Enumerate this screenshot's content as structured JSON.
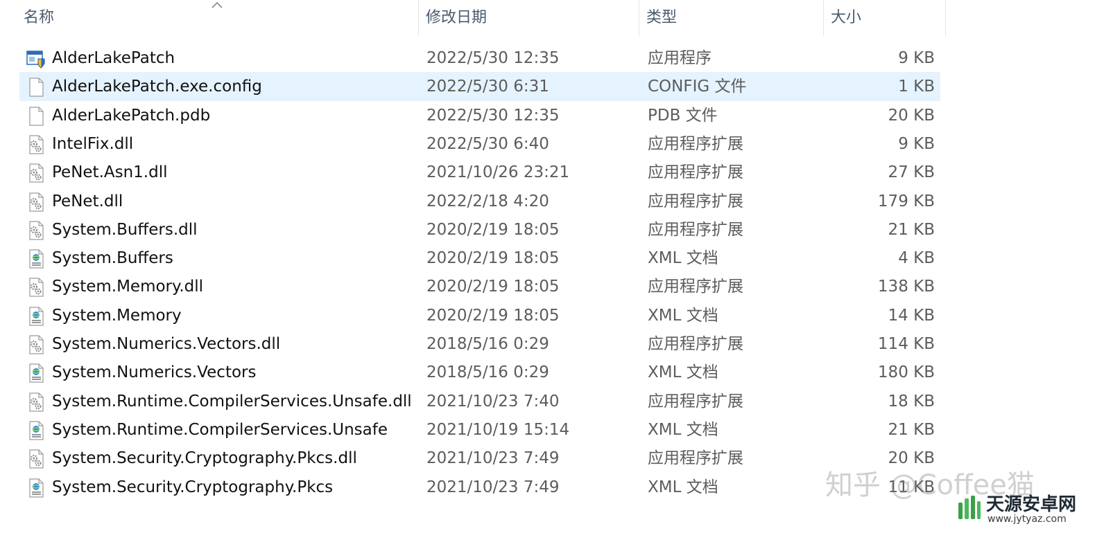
{
  "columns": {
    "name": "名称",
    "date": "修改日期",
    "type": "类型",
    "size": "大小"
  },
  "selected_index": 1,
  "files": [
    {
      "name": "AlderLakePatch",
      "date": "2022/5/30 12:35",
      "type": "应用程序",
      "size": "9 KB",
      "icon": "exe"
    },
    {
      "name": "AlderLakePatch.exe.config",
      "date": "2022/5/30 6:31",
      "type": "CONFIG 文件",
      "size": "1 KB",
      "icon": "file"
    },
    {
      "name": "AlderLakePatch.pdb",
      "date": "2022/5/30 12:35",
      "type": "PDB 文件",
      "size": "20 KB",
      "icon": "file"
    },
    {
      "name": "IntelFix.dll",
      "date": "2022/5/30 6:40",
      "type": "应用程序扩展",
      "size": "9 KB",
      "icon": "dll"
    },
    {
      "name": "PeNet.Asn1.dll",
      "date": "2021/10/26 23:21",
      "type": "应用程序扩展",
      "size": "27 KB",
      "icon": "dll"
    },
    {
      "name": "PeNet.dll",
      "date": "2022/2/18 4:20",
      "type": "应用程序扩展",
      "size": "179 KB",
      "icon": "dll"
    },
    {
      "name": "System.Buffers.dll",
      "date": "2020/2/19 18:05",
      "type": "应用程序扩展",
      "size": "21 KB",
      "icon": "dll"
    },
    {
      "name": "System.Buffers",
      "date": "2020/2/19 18:05",
      "type": "XML 文档",
      "size": "4 KB",
      "icon": "xml"
    },
    {
      "name": "System.Memory.dll",
      "date": "2020/2/19 18:05",
      "type": "应用程序扩展",
      "size": "138 KB",
      "icon": "dll"
    },
    {
      "name": "System.Memory",
      "date": "2020/2/19 18:05",
      "type": "XML 文档",
      "size": "14 KB",
      "icon": "xml"
    },
    {
      "name": "System.Numerics.Vectors.dll",
      "date": "2018/5/16 0:29",
      "type": "应用程序扩展",
      "size": "114 KB",
      "icon": "dll"
    },
    {
      "name": "System.Numerics.Vectors",
      "date": "2018/5/16 0:29",
      "type": "XML 文档",
      "size": "180 KB",
      "icon": "xml"
    },
    {
      "name": "System.Runtime.CompilerServices.Unsafe.dll",
      "date": "2021/10/23 7:40",
      "type": "应用程序扩展",
      "size": "18 KB",
      "icon": "dll"
    },
    {
      "name": "System.Runtime.CompilerServices.Unsafe",
      "date": "2021/10/19 15:14",
      "type": "XML 文档",
      "size": "21 KB",
      "icon": "xml"
    },
    {
      "name": "System.Security.Cryptography.Pkcs.dll",
      "date": "2021/10/23 7:49",
      "type": "应用程序扩展",
      "size": "20 KB",
      "icon": "dll"
    },
    {
      "name": "System.Security.Cryptography.Pkcs",
      "date": "2021/10/23 7:49",
      "type": "XML 文档",
      "size": "11 KB",
      "icon": "xml"
    }
  ],
  "watermark": {
    "zhihu": "知乎 @Coffee猫",
    "site_name": "天源安卓网",
    "site_url": "www.jytyaz.com"
  }
}
